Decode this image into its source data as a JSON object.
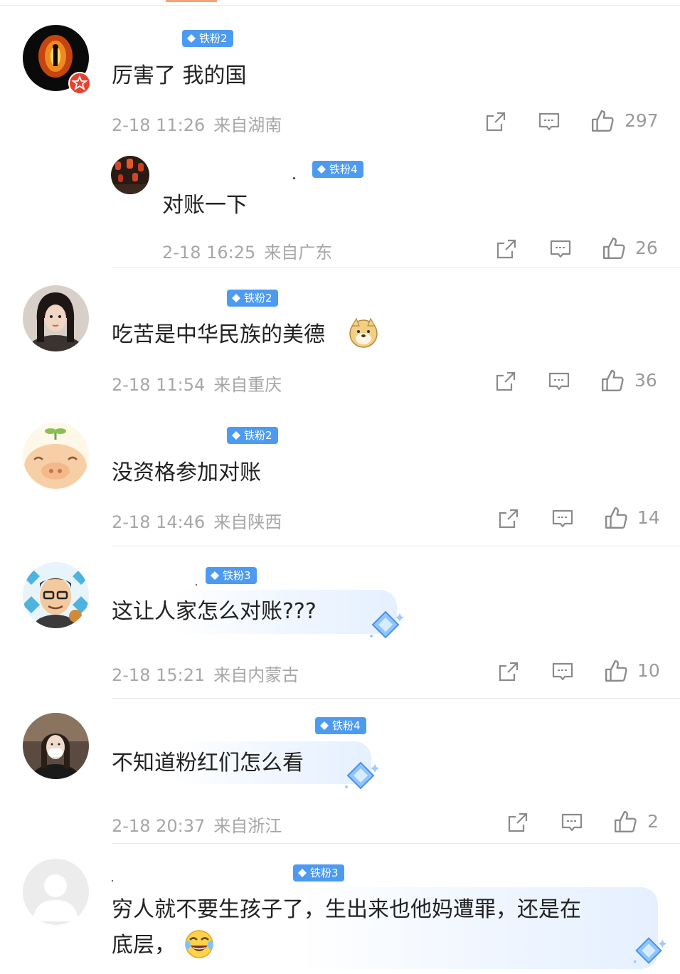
{
  "comments": [
    {
      "avatar": "flame-silhouette-avatar",
      "badge": "铁粉2",
      "text": "厉害了 我的国",
      "time": "2-18 11:26",
      "location": "来自湖南",
      "likes": "297"
    },
    {
      "avatar": "lantern-street-avatar",
      "badge": "铁粉4",
      "text": "对账一下",
      "time": "2-18 16:25",
      "location": "来自广东",
      "likes": "26"
    },
    {
      "avatar": "girl-portrait-avatar",
      "badge": "铁粉2",
      "text": "吃苦是中华民族的美德",
      "emoji": "doge-emoji",
      "time": "2-18 11:54",
      "location": "来自重庆",
      "likes": "36"
    },
    {
      "avatar": "cartoon-pig-avatar",
      "badge": "铁粉2",
      "text": "没资格参加对账",
      "time": "2-18 14:46",
      "location": "来自陕西",
      "likes": "14"
    },
    {
      "avatar": "cartoon-man-glasses-avatar",
      "badge": "铁粉3",
      "text": "这让人家怎么对账???",
      "time": "2-18 15:21",
      "location": "来自内蒙古",
      "likes": "10"
    },
    {
      "avatar": "masked-woman-avatar",
      "badge": "铁粉4",
      "text": "不知道粉红们怎么看",
      "time": "2-18 20:37",
      "location": "来自浙江",
      "likes": "2"
    },
    {
      "avatar": "default-user-avatar",
      "badge": "铁粉3",
      "text_line1": "穷人就不要生孩子了，生出来也他妈遭罪，还是在",
      "text_line2": "底层，",
      "emoji": "laugh-tears-emoji"
    }
  ],
  "colors": {
    "badge": "#4d9bf0",
    "meta": "#a7a7a7",
    "text": "#222222",
    "divider": "#e6e6e6"
  }
}
